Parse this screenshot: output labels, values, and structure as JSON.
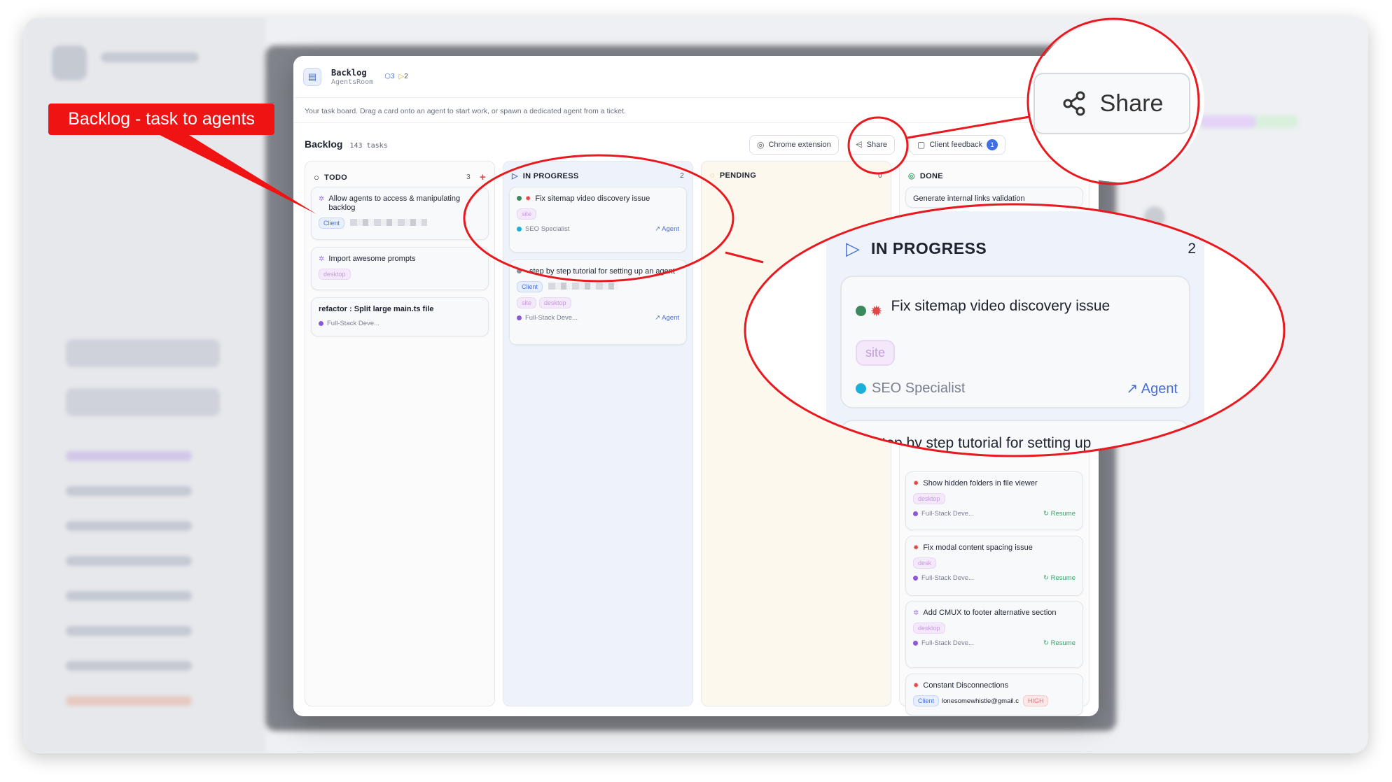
{
  "modal": {
    "title": "Backlog",
    "project": "AgentsRoom",
    "stat_agents": "3",
    "stat_running": "2",
    "hint": "Your task board. Drag a card onto an agent to start work, or spawn a dedicated agent from a ticket.",
    "board_title": "Backlog",
    "task_count": "143 tasks"
  },
  "toolbar": {
    "chrome_extension": "Chrome extension",
    "share": "Share",
    "client_feedback": "Client feedback",
    "client_feedback_badge": "1"
  },
  "columns": {
    "todo": {
      "label": "TODO",
      "count": "3",
      "cards": [
        {
          "title": "Allow agents to access & manipulating backlog",
          "tag": "Client"
        },
        {
          "title": "Import awesome prompts",
          "tag": "desktop"
        },
        {
          "title": "refactor : Split large main.ts file",
          "assignee": "Full-Stack Deve..."
        }
      ]
    },
    "in_progress": {
      "label": "IN PROGRESS",
      "count": "2",
      "cards": [
        {
          "title": "Fix sitemap video discovery issue",
          "tag": "site",
          "assignee": "SEO Specialist",
          "action": "↗ Agent"
        },
        {
          "title": "step by step tutorial for setting up an agent",
          "tag_client": "Client",
          "tags": [
            "site",
            "desktop"
          ],
          "assignee": "Full-Stack Deve...",
          "action": "↗ Agent"
        }
      ]
    },
    "pending": {
      "label": "PENDING",
      "count": "0"
    },
    "done": {
      "label": "DONE",
      "cards": [
        {
          "title": "Generate internal links validation"
        },
        {
          "title": "Show hidden folders in file viewer",
          "tag": "desktop",
          "assignee": "Full-Stack Deve...",
          "action": "Resume"
        },
        {
          "title": "Fix modal content spacing issue",
          "tag": "desk",
          "assignee": "Full-Stack Deve...",
          "action": "Resume"
        },
        {
          "title": "Add CMUX to footer alternative section",
          "tag": "desktop",
          "assignee": "Full-Stack Deve...",
          "action": "Resume"
        },
        {
          "title": "Constant Disconnections",
          "tag": "Client",
          "email": "lonesomewhistle@gmail.c",
          "priority": "HIGH"
        }
      ]
    }
  },
  "callout": {
    "label": "Backlog - task to agents"
  },
  "zoom_share": {
    "label": "Share"
  },
  "zoom_progress": {
    "label": "IN PROGRESS",
    "count": "2",
    "card1_title": "Fix sitemap video discovery issue",
    "card1_tag": "site",
    "card1_assignee": "SEO Specialist",
    "card1_action": "↗ Agent",
    "card2_title": "step by step tutorial for setting up"
  },
  "colors": {
    "annotation_red": "#f01313",
    "accent_blue": "#4a6fd6"
  }
}
